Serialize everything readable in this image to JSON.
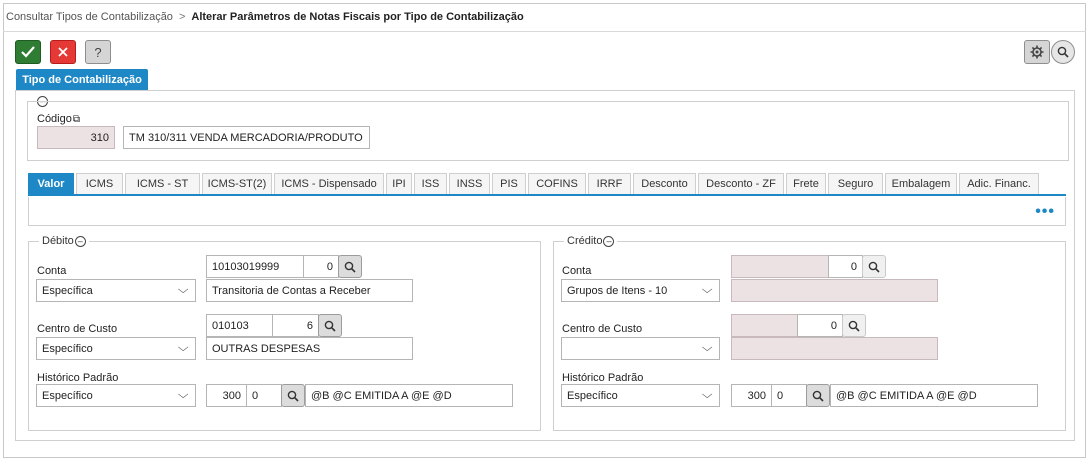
{
  "breadcrumb": {
    "parent": "Consultar Tipos de Contabilização",
    "separator": ">",
    "current": "Alterar Parâmetros de Notas Fiscais por Tipo de Contabilização"
  },
  "toolbar": {
    "confirm_icon": "check-icon",
    "cancel_icon": "x-icon",
    "help_label": "?",
    "settings_icon": "gear-icon",
    "search_icon": "search-icon"
  },
  "section": {
    "title": "Tipo de Contabilização",
    "codigo_label": "Código",
    "codigo_value": "310",
    "descricao_value": "TM 310/311 VENDA MERCADORIA/PRODUTO"
  },
  "tabs": [
    {
      "label": "Valor",
      "active": true
    },
    {
      "label": "ICMS",
      "active": false
    },
    {
      "label": "ICMS - ST",
      "active": false
    },
    {
      "label": "ICMS-ST(2)",
      "active": false
    },
    {
      "label": "ICMS - Dispensado",
      "active": false
    },
    {
      "label": "IPI",
      "active": false
    },
    {
      "label": "ISS",
      "active": false
    },
    {
      "label": "INSS",
      "active": false
    },
    {
      "label": "PIS",
      "active": false
    },
    {
      "label": "COFINS",
      "active": false
    },
    {
      "label": "IRRF",
      "active": false
    },
    {
      "label": "Desconto",
      "active": false
    },
    {
      "label": "Desconto - ZF",
      "active": false
    },
    {
      "label": "Frete",
      "active": false
    },
    {
      "label": "Seguro",
      "active": false
    },
    {
      "label": "Embalagem",
      "active": false
    },
    {
      "label": "Adic. Financ.",
      "active": false
    }
  ],
  "more_label": "•••",
  "debito": {
    "title": "Débito",
    "conta_label": "Conta",
    "conta_tipo": "Específica",
    "conta_codigo": "10103019999",
    "conta_digito": "0",
    "conta_descricao": "Transitoria de Contas a Receber",
    "centro_label": "Centro de Custo",
    "centro_tipo": "Específico",
    "centro_codigo": "010103",
    "centro_digito": "6",
    "centro_descricao": "OUTRAS DESPESAS",
    "historico_label": "Histórico Padrão",
    "historico_tipo": "Específico",
    "historico_codigo": "300",
    "historico_seq": "0",
    "historico_texto": "@B @C EMITIDA A @E @D"
  },
  "credito": {
    "title": "Crédito",
    "conta_label": "Conta",
    "conta_tipo": "Grupos de Itens - 10",
    "conta_codigo": "",
    "conta_digito": "0",
    "conta_descricao": "",
    "centro_label": "Centro de Custo",
    "centro_tipo": "",
    "centro_codigo": "",
    "centro_digito": "0",
    "centro_descricao": "",
    "historico_label": "Histórico Padrão",
    "historico_tipo": "Específico",
    "historico_codigo": "300",
    "historico_seq": "0",
    "historico_texto": "@B @C EMITIDA A @E @D"
  },
  "colors": {
    "accent": "#1e88c7",
    "confirm": "#2e7d32",
    "cancel": "#e53935",
    "readonly_bg": "#ece1e3"
  }
}
